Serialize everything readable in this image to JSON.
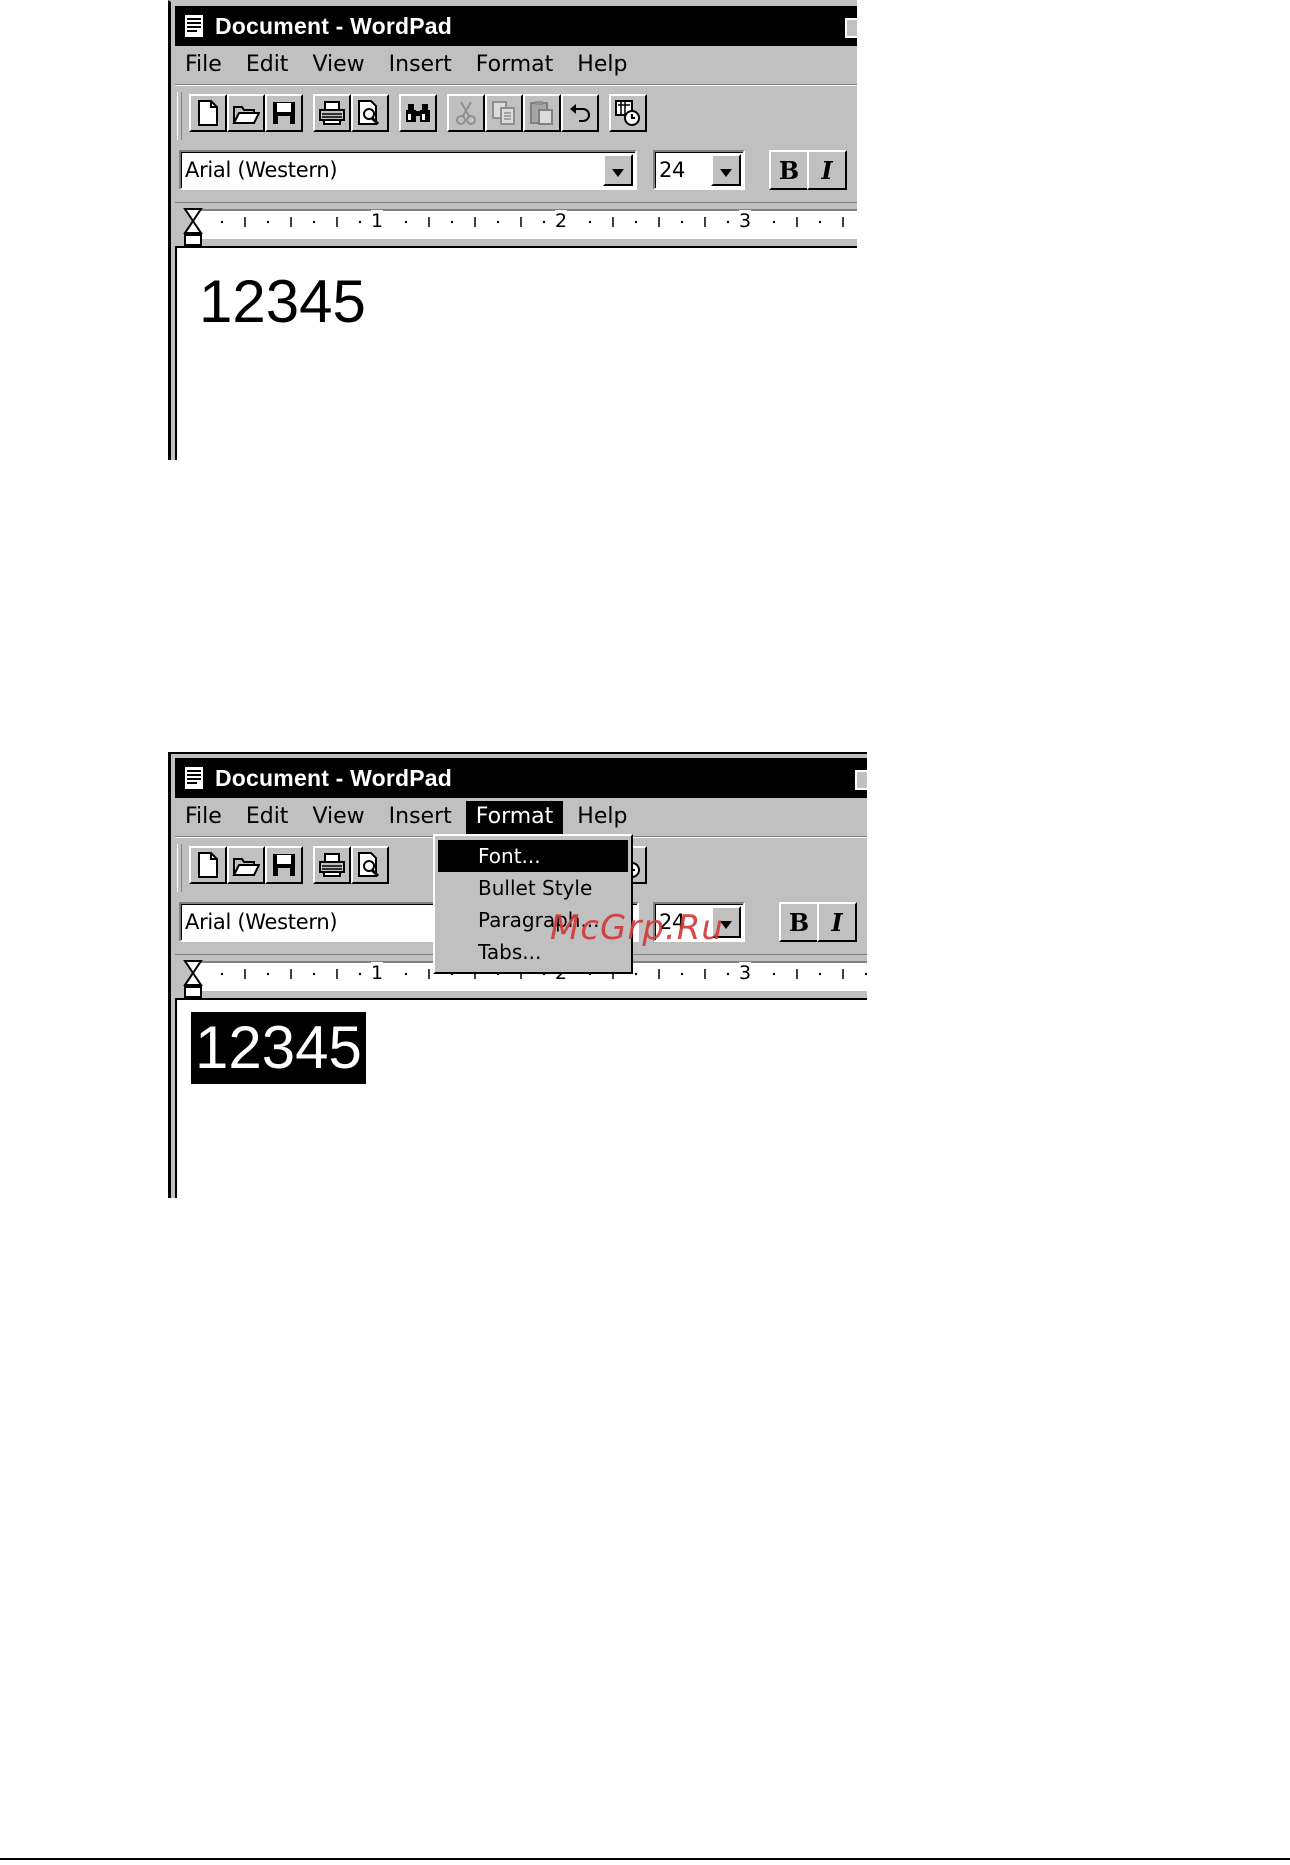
{
  "window1": {
    "title": "Document - WordPad",
    "menu": [
      "File",
      "Edit",
      "View",
      "Insert",
      "Format",
      "Help"
    ],
    "font_name": "Arial (Western)",
    "font_size": "24",
    "bold_label": "B",
    "italic_label": "I",
    "ruler_numbers": [
      "1",
      "2",
      "3"
    ],
    "document_text": "12345"
  },
  "window2": {
    "title": "Document - WordPad",
    "menu": [
      "File",
      "Edit",
      "View",
      "Insert",
      "Format",
      "Help"
    ],
    "active_menu": "Format",
    "font_name": "Arial (Western)",
    "font_size": "24",
    "bold_label": "B",
    "italic_label": "I",
    "ruler_numbers": [
      "1",
      "2",
      "3"
    ],
    "document_text": "12345",
    "format_menu": {
      "items": [
        "Font...",
        "Bullet Style",
        "Paragraph...",
        "Tabs..."
      ],
      "highlighted": "Font..."
    }
  },
  "watermark": "McGrp.Ru",
  "toolbar_icons": [
    "new-icon",
    "open-icon",
    "save-icon",
    "print-icon",
    "print-preview-icon",
    "find-icon",
    "cut-icon",
    "copy-icon",
    "paste-icon",
    "undo-icon",
    "insert-datetime-icon"
  ],
  "colors": {
    "window_face": "#c0c0c0",
    "titlebar": "#000000",
    "selection": "#000000",
    "watermark": "#d23a3a"
  }
}
